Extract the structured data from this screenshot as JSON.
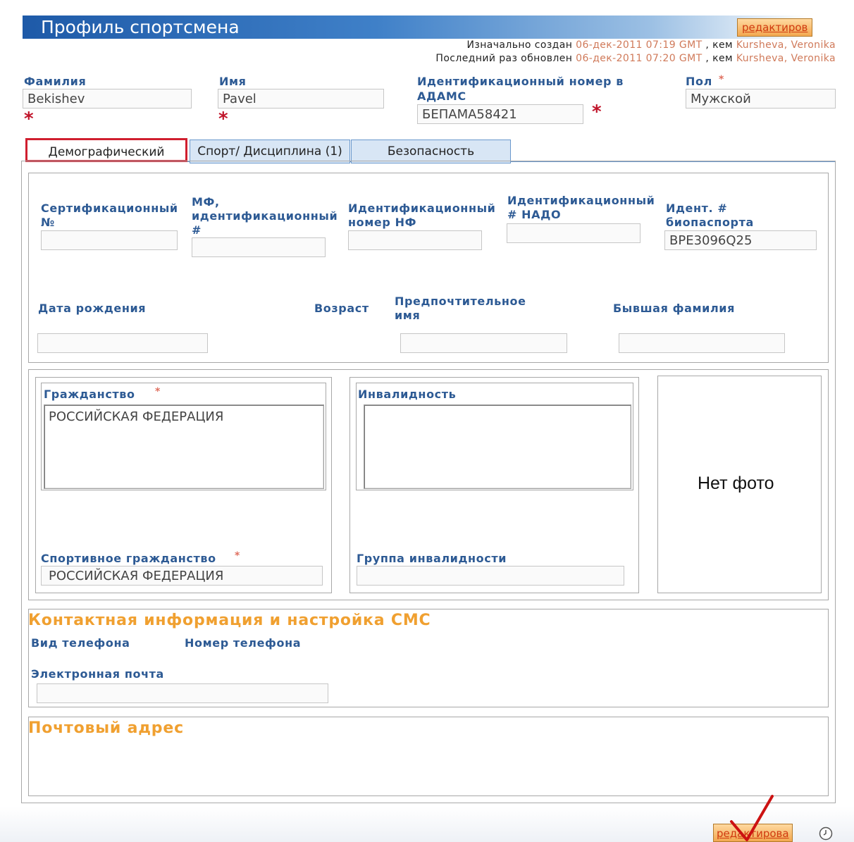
{
  "header": {
    "title": "Профиль спортсмена",
    "edit_label": "редактиров",
    "created_prefix": "Изначально создан",
    "created_date": "06-дек-2011 07:19 GMT",
    "updated_prefix": "Последний раз обновлен",
    "updated_date": "06-дек-2011 07:20 GMT",
    "by_label": ", кем",
    "user": "Kursheva, Veronika"
  },
  "identity": {
    "surname_label": "Фамилия",
    "surname_value": "Bekishev",
    "name_label": "Имя",
    "name_value": "Pavel",
    "adams_label_line1": "Идентификационный номер в",
    "adams_label_line2": "АДАМС",
    "adams_value": "БЕПАМА58421",
    "gender_label": "Пол",
    "gender_value": "Мужской",
    "required_mark": "*"
  },
  "tabs": [
    {
      "label": "Демографический",
      "active": true
    },
    {
      "label": "Спорт/ Дисциплина (1)",
      "active": false
    },
    {
      "label": "Безопасность",
      "active": false
    }
  ],
  "demographic": {
    "cert_label": "Сертификационный №",
    "mf_label": "МФ, идентификационный #",
    "nf_label": "Идентификационный номер НФ",
    "nado_label": "Идентификационный # НАДО",
    "biopassport_label": "Идент. # биопаспорта",
    "biopassport_value": "BPE3096Q25",
    "dob_label": "Дата рождения",
    "age_label": "Возраст",
    "preferred_label": "Предпочтительное имя",
    "former_label": "Бывшая фамилия"
  },
  "citizenship": {
    "label": "Гражданство",
    "value": "РОССИЙСКАЯ ФЕДЕРАЦИЯ",
    "sport_label": "Спортивное гражданство",
    "sport_value": "РОССИЙСКАЯ ФЕДЕРАЦИЯ"
  },
  "disability": {
    "label": "Инвалидность",
    "group_label": "Группа инвалидности"
  },
  "photo": {
    "placeholder": "Нет фото"
  },
  "contact": {
    "title": "Контактная информация и настройка СМС",
    "phone_type_label": "Вид телефона",
    "phone_number_label": "Номер телефона",
    "email_label": "Электронная почта"
  },
  "postal": {
    "title": "Почтовый адрес"
  },
  "footer": {
    "edit_label": "редактирова"
  },
  "colors": {
    "title_bar": "#1e5aa8",
    "label_blue": "#2d5a94",
    "required_red": "#c0142a",
    "section_orange": "#f0a030",
    "edit_orange": "#f2a850"
  }
}
